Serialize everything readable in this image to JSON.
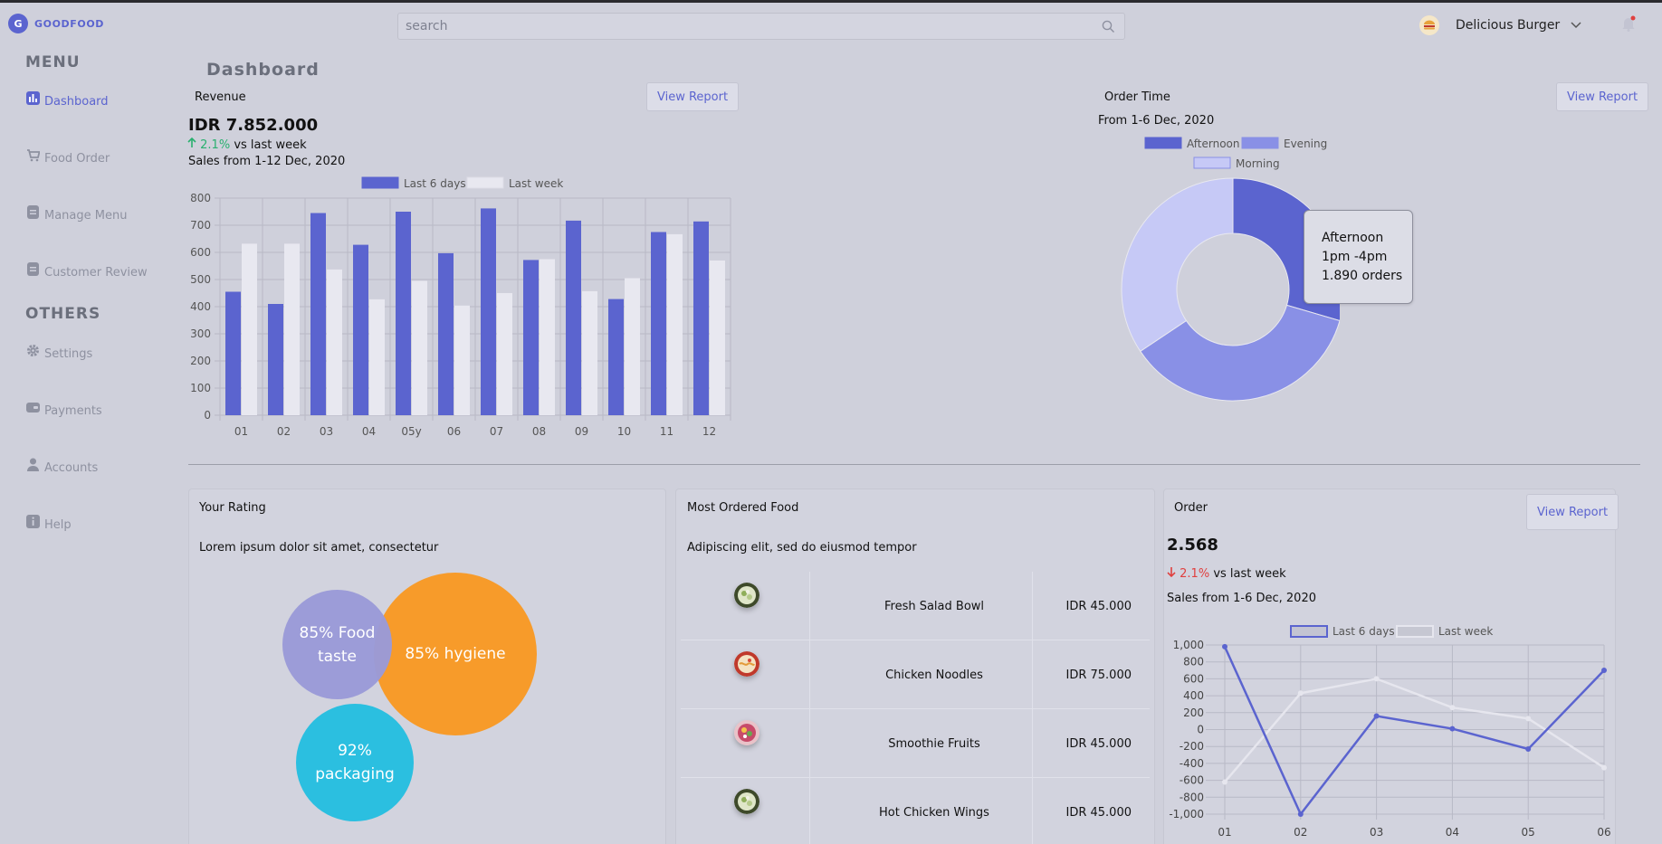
{
  "app": {
    "logo_letter": "G",
    "name": "GOODFOOD"
  },
  "sidebar": {
    "menu_heading": "MENU",
    "others_heading": "OTHERS",
    "menu_items": [
      {
        "label": "Dashboard",
        "icon": "chart-icon"
      },
      {
        "label": "Food Order",
        "icon": "cart-icon"
      },
      {
        "label": "Manage Menu",
        "icon": "document-icon"
      },
      {
        "label": "Customer Review",
        "icon": "document-icon"
      }
    ],
    "other_items": [
      {
        "label": "Settings",
        "icon": "gear-icon"
      },
      {
        "label": "Payments",
        "icon": "wallet-icon"
      },
      {
        "label": "Accounts",
        "icon": "user-icon"
      },
      {
        "label": "Help",
        "icon": "info-icon"
      }
    ]
  },
  "header": {
    "search_placeholder": "search",
    "user_name": "Delicious Burger"
  },
  "page": {
    "title": "Dashboard"
  },
  "revenue": {
    "title": "Revenue",
    "button": "View Report",
    "amount": "IDR 7.852.000",
    "delta_pct": "2.1%",
    "delta_text": "vs last week",
    "subtitle": "Sales from 1-12 Dec, 2020"
  },
  "order_time": {
    "title": "Order Time",
    "button": "View Report",
    "subtitle": "From 1-6 Dec, 2020",
    "tooltip": {
      "label": "Afternoon",
      "time": "1pm -4pm",
      "orders": "1.890 orders"
    }
  },
  "rating": {
    "title": "Your Rating",
    "subtitle": "Lorem ipsum dolor sit amet, consectetur",
    "bubbles": [
      {
        "text": "85% Food taste",
        "color": "#9a9ad8"
      },
      {
        "text": "85% hygiene",
        "color": "#f79b2a"
      },
      {
        "text": "92% packaging",
        "color": "#2bbfe0"
      }
    ]
  },
  "most_ordered": {
    "title": "Most Ordered Food",
    "subtitle": "Adipiscing elit, sed do eiusmod tempor",
    "items": [
      {
        "name": "Fresh Salad Bowl",
        "price": "IDR 45.000",
        "icon": "salad-bowl-image"
      },
      {
        "name": "Chicken Noodles",
        "price": "IDR 75.000",
        "icon": "noodles-image"
      },
      {
        "name": "Smoothie Fruits",
        "price": "IDR 45.000",
        "icon": "smoothie-image"
      },
      {
        "name": "Hot Chicken Wings",
        "price": "IDR 45.000",
        "icon": "salad-bowl-image"
      }
    ]
  },
  "order": {
    "title": "Order",
    "button": "View Report",
    "amount": "2.568",
    "delta_pct": "2.1%",
    "delta_text": "vs last week",
    "subtitle": "Sales from 1-6 Dec, 2020"
  },
  "colors": {
    "accent": "#5b64cf",
    "light_bar": "#e8e8f0",
    "up": "#2ab06f",
    "down": "#e0403f"
  },
  "chart_data": [
    {
      "type": "bar",
      "categories": [
        "01",
        "02",
        "03",
        "04",
        "05y",
        "06",
        "07",
        "08",
        "09",
        "10",
        "11",
        "12"
      ],
      "series": [
        {
          "name": "Last 6 days",
          "color": "#5b64cf",
          "values": [
            455,
            410,
            745,
            628,
            750,
            597,
            762,
            572,
            717,
            428,
            675,
            714
          ]
        },
        {
          "name": "Last week",
          "color": "#e8e8f0",
          "values": [
            632,
            632,
            537,
            427,
            495,
            404,
            450,
            575,
            457,
            505,
            667,
            570
          ]
        }
      ],
      "ylim": [
        0,
        800
      ],
      "yticks": [
        0,
        100,
        200,
        300,
        400,
        500,
        600,
        700,
        800
      ],
      "grid": true,
      "legend": "top"
    },
    {
      "type": "pie",
      "donut": true,
      "labels": [
        "Afternoon",
        "Evening",
        "Morning"
      ],
      "colors": [
        "#5b64cf",
        "#8990e6",
        "#c6c9f6"
      ],
      "values": [
        1890,
        2310,
        2200
      ],
      "legend": "top"
    },
    {
      "type": "line",
      "categories": [
        "01",
        "02",
        "03",
        "04",
        "05",
        "06"
      ],
      "series": [
        {
          "name": "Last 6 days",
          "color": "#5b64cf",
          "values": [
            980,
            -1000,
            160,
            10,
            -230,
            700
          ]
        },
        {
          "name": "Last week",
          "color": "#e6e6ee",
          "values": [
            -620,
            430,
            600,
            260,
            130,
            -450
          ]
        }
      ],
      "ylim": [
        -1000,
        1000
      ],
      "yticks": [
        "1,000",
        "800",
        "600",
        "400",
        "200",
        "0",
        "-200",
        "-400",
        "-600",
        "-800",
        "-1,000"
      ],
      "grid": true,
      "legend": "top"
    }
  ]
}
